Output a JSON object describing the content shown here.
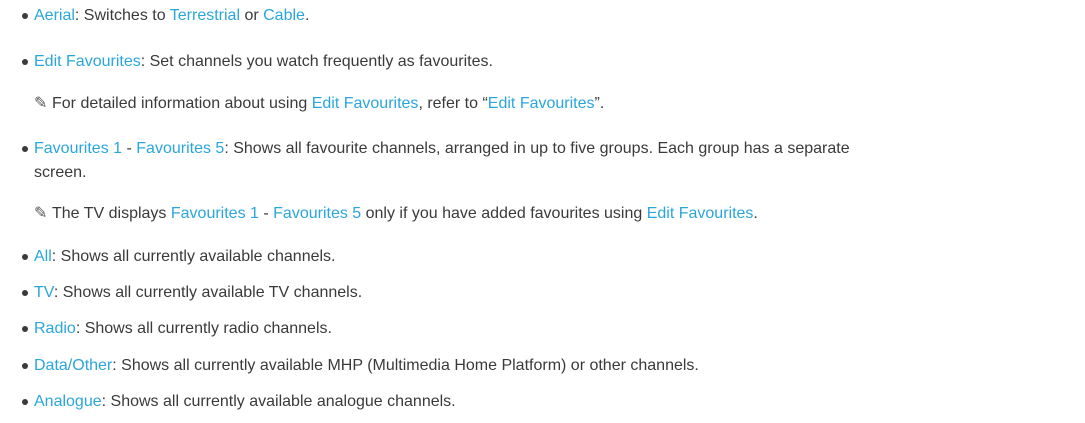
{
  "items": [
    {
      "term": "Aerial",
      "text": ": Switches to ",
      "link1": "Terrestrial",
      "mid": " or ",
      "link2": "Cable",
      "end": "."
    },
    {
      "term": "Edit Favourites",
      "text": ": Set channels you watch frequently as favourites."
    },
    {
      "note_pre": "For detailed information about using ",
      "note_link1": "Edit Favourites",
      "note_mid": ", refer to “",
      "note_link2": "Edit Favourites",
      "note_end": "”."
    },
    {
      "term1": "Favourites 1",
      "sep": " - ",
      "term2": "Favourites 5",
      "text": ": Shows all favourite channels, arranged in up to five groups. Each group has a separate",
      "text2": "screen."
    },
    {
      "note_pre": "The TV displays ",
      "note_link1": "Favourites 1",
      "note_sep": " - ",
      "note_link2": "Favourites 5",
      "note_mid": " only if you have added favourites using ",
      "note_link3": "Edit Favourites",
      "note_end": "."
    },
    {
      "term": "All",
      "text": ": Shows all currently available channels."
    },
    {
      "term": "TV",
      "text": ": Shows all currently available TV channels."
    },
    {
      "term": "Radio",
      "text": ": Shows all currently radio channels."
    },
    {
      "term": "Data/Other",
      "text": ": Shows all currently available MHP (Multimedia Home Platform) or other channels."
    },
    {
      "term": "Analogue",
      "text": ": Shows all currently available analogue channels."
    }
  ],
  "colors": {
    "highlight": "#2aa6dc",
    "text": "#3a3a3a"
  },
  "icons": {
    "note": "pencil-icon"
  }
}
